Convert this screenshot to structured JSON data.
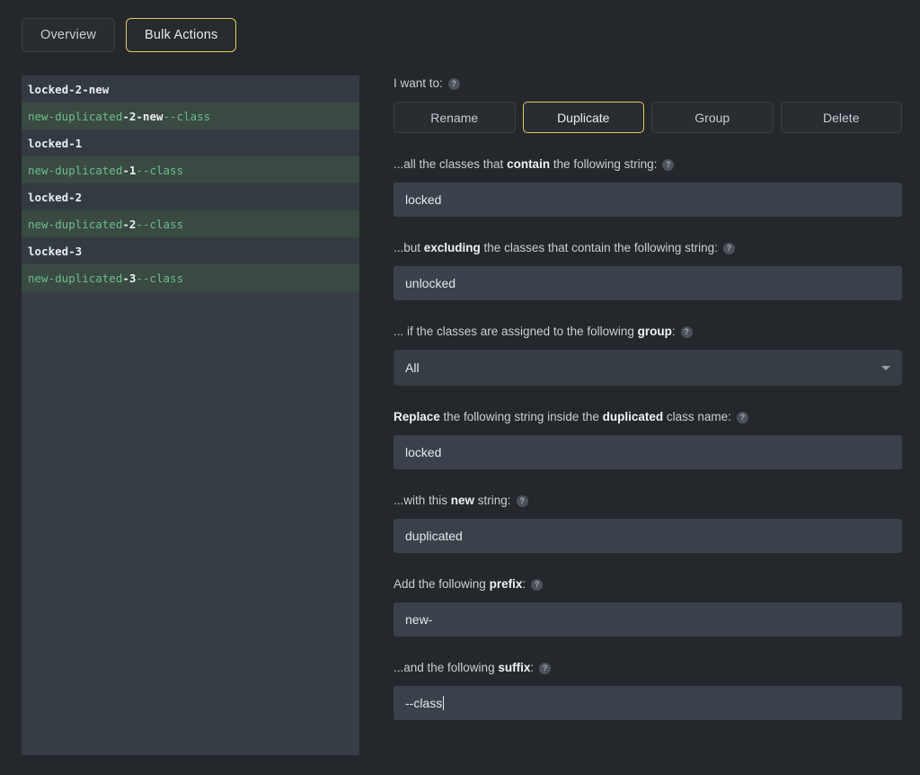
{
  "tabs": [
    {
      "label": "Overview",
      "active": false
    },
    {
      "label": "Bulk Actions",
      "active": true
    }
  ],
  "class_list": [
    {
      "prefix": "",
      "core": "locked-2-new",
      "suffix": "",
      "type": "plain"
    },
    {
      "prefix": "new-duplicated",
      "core": "-2-new",
      "suffix": "--class",
      "type": "created"
    },
    {
      "prefix": "",
      "core": "locked-1",
      "suffix": "",
      "type": "plain"
    },
    {
      "prefix": "new-duplicated",
      "core": "-1",
      "suffix": "--class",
      "type": "created"
    },
    {
      "prefix": "",
      "core": "locked-2",
      "suffix": "",
      "type": "plain"
    },
    {
      "prefix": "new-duplicated",
      "core": "-2",
      "suffix": "--class",
      "type": "created"
    },
    {
      "prefix": "",
      "core": "locked-3",
      "suffix": "",
      "type": "plain"
    },
    {
      "prefix": "new-duplicated",
      "core": "-3",
      "suffix": "--class",
      "type": "created"
    }
  ],
  "form": {
    "intent_label": "I want to:",
    "actions": [
      {
        "label": "Rename",
        "selected": false
      },
      {
        "label": "Duplicate",
        "selected": true
      },
      {
        "label": "Group",
        "selected": false
      },
      {
        "label": "Delete",
        "selected": false
      }
    ],
    "contain": {
      "label_pre": "...all the classes that ",
      "label_bold": "contain",
      "label_post": " the following string:",
      "value": "locked",
      "placeholder": ""
    },
    "exclude": {
      "label_pre": "...but ",
      "label_bold": "excluding",
      "label_post": " the classes that contain the following string:",
      "value": "unlocked",
      "placeholder": ""
    },
    "group": {
      "label_pre": "... if the classes are assigned to the following ",
      "label_bold": "group",
      "label_post": ":",
      "value": "All",
      "options": [
        "All"
      ]
    },
    "replace": {
      "label_pre": "",
      "label_bold": "Replace",
      "label_mid": " the following string inside the ",
      "label_bold2": "duplicated",
      "label_post": " class name:",
      "value": "locked"
    },
    "new_string": {
      "label_pre": "...with this ",
      "label_bold": "new",
      "label_post": " string:",
      "value": "duplicated"
    },
    "prefix": {
      "label_pre": "Add the following ",
      "label_bold": "prefix",
      "label_post": ":",
      "value": "new-"
    },
    "suffix": {
      "label_pre": "...and the following ",
      "label_bold": "suffix",
      "label_post": ":",
      "value": "--class",
      "focused": true
    }
  },
  "icons": {
    "help": "?",
    "chevron_down": "chevron-down-icon"
  },
  "colors": {
    "page_bg": "#24282c",
    "panel_bg": "#383e46",
    "row_plain": "#343a42",
    "row_created": "#3a4a42",
    "accent_yellow": "#e8c760",
    "green_text": "#6cbb8c",
    "input_bg": "#3b414a"
  }
}
